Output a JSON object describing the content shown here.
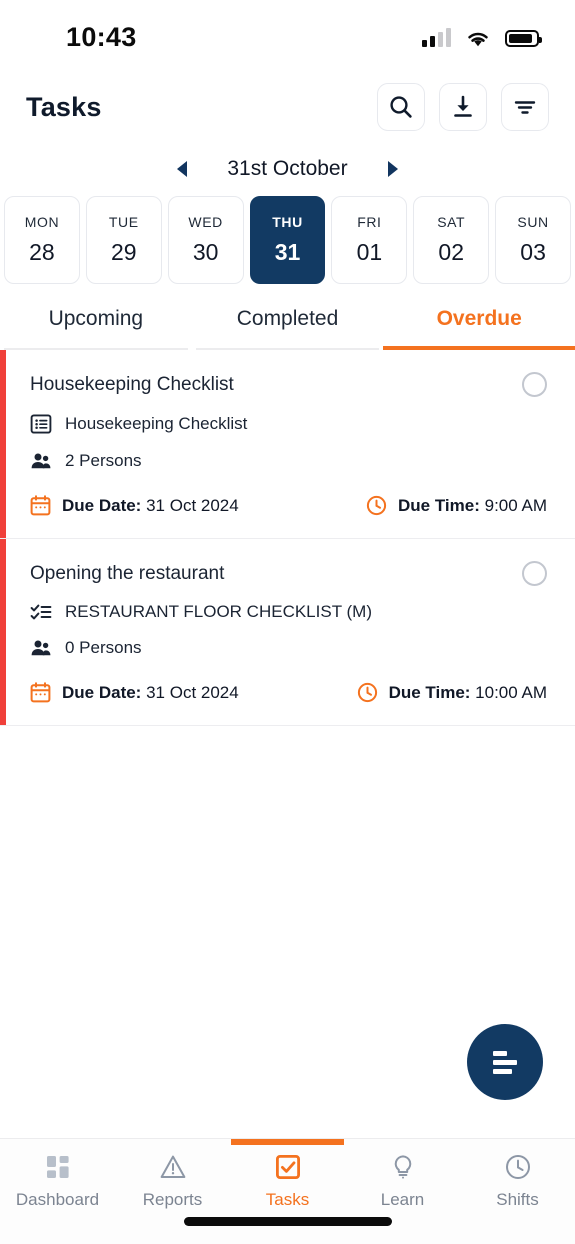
{
  "status_bar": {
    "time": "10:43",
    "signal_icon": "signal-bars-icon",
    "wifi_icon": "wifi-icon",
    "battery_icon": "battery-full-icon"
  },
  "header": {
    "title": "Tasks",
    "actions": [
      {
        "name": "search-icon",
        "label": "Search"
      },
      {
        "name": "download-icon",
        "label": "Download"
      },
      {
        "name": "filter-icon",
        "label": "Filter"
      }
    ]
  },
  "date_nav": {
    "prev_label": "Previous",
    "next_label": "Next",
    "current": "31st October"
  },
  "days": [
    {
      "dow": "MON",
      "dom": "28",
      "selected": false
    },
    {
      "dow": "TUE",
      "dom": "29",
      "selected": false
    },
    {
      "dow": "WED",
      "dom": "30",
      "selected": false
    },
    {
      "dow": "THU",
      "dom": "31",
      "selected": true
    },
    {
      "dow": "FRI",
      "dom": "01",
      "selected": false
    },
    {
      "dow": "SAT",
      "dom": "02",
      "selected": false
    },
    {
      "dow": "SUN",
      "dom": "03",
      "selected": false
    }
  ],
  "tabs": [
    {
      "label": "Upcoming",
      "active": false
    },
    {
      "label": "Completed",
      "active": false
    },
    {
      "label": "Overdue",
      "active": true
    }
  ],
  "tasks": [
    {
      "title": "Housekeeping Checklist",
      "checklist_icon": "list-box-icon",
      "checklist": "Housekeeping Checklist",
      "persons_icon": "persons-icon",
      "persons": "2 Persons",
      "due_date_icon": "calendar-icon",
      "due_date_label": "Due Date:",
      "due_date_value": "31 Oct 2024",
      "due_time_icon": "clock-icon",
      "due_time_label": "Due Time:",
      "due_time_value": "9:00 AM",
      "accent_color": "#f0403a",
      "completed": false
    },
    {
      "title": "Opening the restaurant",
      "checklist_icon": "checklist-icon",
      "checklist": "RESTAURANT FLOOR CHECKLIST (M)",
      "persons_icon": "persons-icon",
      "persons": "0 Persons",
      "due_date_icon": "calendar-icon",
      "due_date_label": "Due Date:",
      "due_date_value": "31 Oct 2024",
      "due_time_icon": "clock-icon",
      "due_time_label": "Due Time:",
      "due_time_value": "10:00 AM",
      "accent_color": "#f0403a",
      "completed": false
    }
  ],
  "fab": {
    "name": "sort-lines-icon",
    "label": "Sort"
  },
  "bottom_nav": [
    {
      "label": "Dashboard",
      "icon": "dashboard-grid-icon",
      "active": false
    },
    {
      "label": "Reports",
      "icon": "warning-triangle-icon",
      "active": false
    },
    {
      "label": "Tasks",
      "icon": "checkbox-checked-icon",
      "active": true
    },
    {
      "label": "Learn",
      "icon": "lightbulb-icon",
      "active": false
    },
    {
      "label": "Shifts",
      "icon": "clock-icon",
      "active": false
    }
  ],
  "colors": {
    "accent_orange": "#f4721f",
    "navy": "#123a63",
    "overdue_red": "#f0403a"
  }
}
